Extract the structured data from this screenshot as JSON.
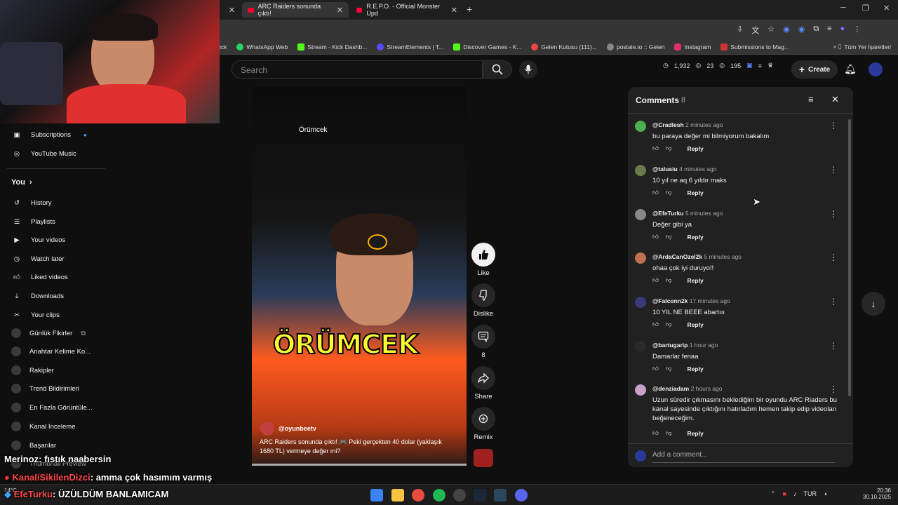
{
  "browser": {
    "tabs": [
      {
        "label": "ARC Raiders sonunda çıktı!"
      },
      {
        "label": "R.E.P.O. - Official Monster Upd"
      }
    ],
    "bookmarks": [
      "ick",
      "WhatsApp Web",
      "Stream - Kick Dashb...",
      "StreamElements | T...",
      "Discover Games - K...",
      "Gelen Kutusu (111)...",
      "postale.io :: Gelen",
      "Instagram",
      "Submissions to Mag...",
      "Tüm Yer İşaretleri"
    ]
  },
  "header": {
    "search_placeholder": "Search",
    "stats": [
      "1,932",
      "23",
      "195"
    ],
    "create_label": "Create"
  },
  "sidebar": {
    "items": [
      {
        "label": "Subscriptions"
      },
      {
        "label": "YouTube Music"
      }
    ],
    "you_label": "You",
    "you_items": [
      {
        "label": "History"
      },
      {
        "label": "Playlists"
      },
      {
        "label": "Your videos"
      },
      {
        "label": "Watch later"
      },
      {
        "label": "Liked videos"
      },
      {
        "label": "Downloads"
      },
      {
        "label": "Your clips"
      },
      {
        "label": "Günlük Fikirler"
      },
      {
        "label": "Anahtar Kelime Ko..."
      },
      {
        "label": "Rakipler"
      },
      {
        "label": "Trend Bildirimleri"
      },
      {
        "label": "En Fazla Görüntüle..."
      },
      {
        "label": "Kanal Inceleme"
      },
      {
        "label": "Başarılar"
      },
      {
        "label": "Thumbnail Preview"
      }
    ]
  },
  "video": {
    "overlay_label": "Örümcek",
    "big_title": "ÖRÜMCEK",
    "channel": "@oyunbeetv",
    "caption": "ARC Raiders sonunda çıktı! 🎮 Peki gerçekten 40 dolar (yaklaşık 1680 TL) vermeye değer mi?"
  },
  "actions": {
    "like": "Like",
    "dislike": "Dislike",
    "comments_count": "8",
    "share": "Share",
    "remix": "Remix"
  },
  "comments": {
    "title": "Comments",
    "count": "8",
    "add_placeholder": "Add a comment...",
    "reply_label": "Reply",
    "items": [
      {
        "handle": "@Cradlesh",
        "time": "2 minutes ago",
        "text": "bu paraya değer mi bilmiyorum bakalım",
        "color": "#4caf50"
      },
      {
        "handle": "@talusiu",
        "time": "4 minutes ago",
        "text": "10 yıl ne aq 6 yıldır maks",
        "color": "#6a7a4a"
      },
      {
        "handle": "@EfeTurku",
        "time": "5 minutes ago",
        "text": "Değer gibi ya",
        "color": "#888888"
      },
      {
        "handle": "@ArdaCanOzel2k",
        "time": "5 minutes ago",
        "text": "ohaa çok iyi duruyo!!",
        "color": "#c07050"
      },
      {
        "handle": "@Falconn2k",
        "time": "17 minutes ago",
        "text": "10 YIL NE BEEE abartııı",
        "color": "#3a3a7a"
      },
      {
        "handle": "@bartugarip",
        "time": "1 hour ago",
        "text": "Damarlar fenaa",
        "color": "#2a2a2a"
      },
      {
        "handle": "@denziadam",
        "time": "2 hours ago",
        "text": "Uzun süredir çıkmasını beklediğim bir oyundu ARC Riaders bu kanal sayesinde çıktığını hatırladım hemen takip edip videoları beğeneceğim.",
        "color": "#c9a0c9"
      }
    ]
  },
  "stream_chat": [
    {
      "user": "Merinoz",
      "text": ": fıstık naabersin",
      "color": "#ffffff"
    },
    {
      "user": "KanaliSikilenDizci",
      "text": ": amma çok hasımım varmış",
      "color": "#ff4a4a"
    },
    {
      "user": "EfeTurku",
      "text": ": ÜZÜLDÜM BANLAMICAM",
      "color": "#ff4a4a"
    }
  ],
  "taskbar": {
    "weather": "14°C",
    "lang": "TUR",
    "time": "20:36",
    "date": "30.10.2025"
  },
  "colors": {
    "accent_red": "#ff0033",
    "yellow_title": "#fffb32"
  }
}
